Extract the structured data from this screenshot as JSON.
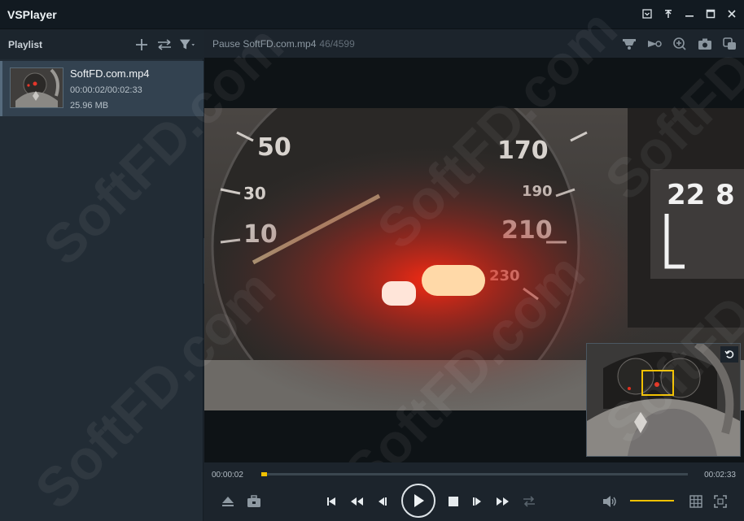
{
  "app": {
    "title": "VSPlayer"
  },
  "playlist": {
    "title": "Playlist",
    "items": [
      {
        "name": "SoftFD.com.mp4",
        "time": "00:00:02/00:02:33",
        "size": "25.96 MB"
      }
    ]
  },
  "player": {
    "status": "Pause SoftFD.com.mp4",
    "frames": "46/4599",
    "current_time": "00:00:02",
    "total_time": "00:02:33",
    "progress_fraction": 0.013,
    "volume_fraction": 1.0
  },
  "watermark": "SoftFD.com",
  "colors": {
    "accent": "#f2c100",
    "background": "#1c242c",
    "titlebar": "#121a21",
    "selected_item": "#334250"
  },
  "icons": {
    "window": [
      "dropdown-menu-icon",
      "pin-icon",
      "minimize-icon",
      "maximize-icon",
      "close-icon"
    ],
    "playlist_tools": [
      "add-icon",
      "swap-order-icon",
      "filter-icon"
    ],
    "main_tools": [
      "fisheye-icon",
      "video-enhance-icon",
      "zoom-in-icon",
      "snapshot-icon",
      "multi-window-icon"
    ],
    "controls": [
      "eject-icon",
      "toolbox-icon",
      "step-back-icon",
      "slow-rewind-icon",
      "previous-frame-icon",
      "play-icon",
      "stop-icon",
      "next-frame-icon",
      "fast-forward-icon",
      "repeat-icon",
      "volume-icon",
      "grid-icon",
      "fullscreen-icon"
    ]
  }
}
